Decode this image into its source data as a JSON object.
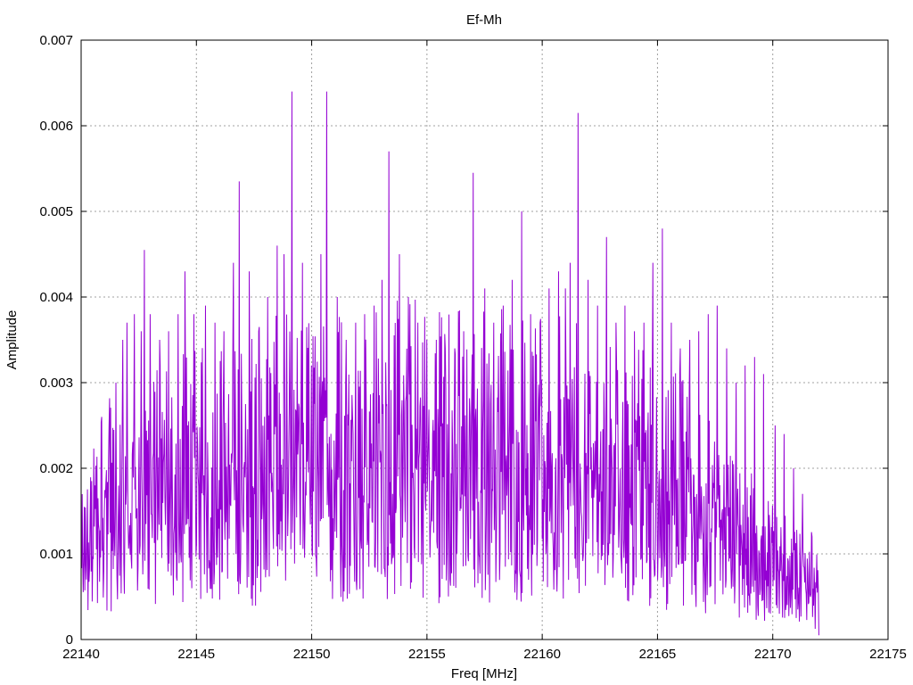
{
  "chart_data": {
    "type": "line",
    "title": "Ef-Mh",
    "xlabel": "Freq [MHz]",
    "ylabel": "Amplitude",
    "xlim": [
      22140,
      22175
    ],
    "ylim": [
      0,
      0.007
    ],
    "xticks": [
      22140,
      22145,
      22150,
      22155,
      22160,
      22165,
      22170,
      22175
    ],
    "yticks": [
      0,
      0.001,
      0.002,
      0.003,
      0.004,
      0.005,
      0.006,
      0.007
    ],
    "xtick_labels": [
      "22140",
      "22145",
      "22150",
      "22155",
      "22160",
      "22165",
      "22170",
      "22175"
    ],
    "ytick_labels": [
      "0",
      "0.001",
      "0.002",
      "0.003",
      "0.004",
      "0.005",
      "0.006",
      "0.007"
    ],
    "grid": true,
    "line_color": "#9400d3",
    "series": [
      {
        "x_start": 22140.0,
        "x_end": 22172.0,
        "peaks": [
          [
            22140.6,
            0.0018
          ],
          [
            22140.9,
            0.0026
          ],
          [
            22141.2,
            0.0025
          ],
          [
            22141.5,
            0.003
          ],
          [
            22141.8,
            0.0035
          ],
          [
            22142.0,
            0.0037
          ],
          [
            22142.3,
            0.0038
          ],
          [
            22142.6,
            0.0036
          ],
          [
            22142.75,
            0.00455
          ],
          [
            22143.0,
            0.0038
          ],
          [
            22143.4,
            0.0035
          ],
          [
            22143.8,
            0.0036
          ],
          [
            22144.2,
            0.0038
          ],
          [
            22144.5,
            0.0043
          ],
          [
            22144.9,
            0.0038
          ],
          [
            22145.4,
            0.0039
          ],
          [
            22145.8,
            0.0037
          ],
          [
            22146.2,
            0.0036
          ],
          [
            22146.6,
            0.0044
          ],
          [
            22146.85,
            0.00535
          ],
          [
            22147.3,
            0.0043
          ],
          [
            22147.7,
            0.0036
          ],
          [
            22148.1,
            0.004
          ],
          [
            22148.5,
            0.0046
          ],
          [
            22148.8,
            0.0045
          ],
          [
            22149.15,
            0.0064
          ],
          [
            22149.6,
            0.0044
          ],
          [
            22150.0,
            0.0032
          ],
          [
            22150.4,
            0.0045
          ],
          [
            22150.65,
            0.0064
          ],
          [
            22151.1,
            0.004
          ],
          [
            22151.5,
            0.0035
          ],
          [
            22151.9,
            0.0037
          ],
          [
            22152.3,
            0.0038
          ],
          [
            22152.7,
            0.0039
          ],
          [
            22153.05,
            0.0042
          ],
          [
            22153.35,
            0.0057
          ],
          [
            22153.8,
            0.0045
          ],
          [
            22154.2,
            0.004
          ],
          [
            22154.6,
            0.0037
          ],
          [
            22155.0,
            0.0035
          ],
          [
            22155.4,
            0.0035
          ],
          [
            22155.8,
            0.0034
          ],
          [
            22156.2,
            0.0034
          ],
          [
            22156.6,
            0.0036
          ],
          [
            22157.0,
            0.00545
          ],
          [
            22157.5,
            0.0041
          ],
          [
            22157.9,
            0.0037
          ],
          [
            22158.3,
            0.0039
          ],
          [
            22158.7,
            0.0042
          ],
          [
            22159.1,
            0.005
          ],
          [
            22159.5,
            0.0038
          ],
          [
            22159.9,
            0.0037
          ],
          [
            22160.3,
            0.0041
          ],
          [
            22160.7,
            0.0043
          ],
          [
            22161.0,
            0.0041
          ],
          [
            22161.2,
            0.0044
          ],
          [
            22161.55,
            0.00615
          ],
          [
            22162.0,
            0.0042
          ],
          [
            22162.4,
            0.0039
          ],
          [
            22162.8,
            0.0047
          ],
          [
            22163.2,
            0.0037
          ],
          [
            22163.6,
            0.0039
          ],
          [
            22164.0,
            0.0036
          ],
          [
            22164.4,
            0.0037
          ],
          [
            22164.8,
            0.0044
          ],
          [
            22165.2,
            0.0048
          ],
          [
            22165.6,
            0.0037
          ],
          [
            22166.0,
            0.0034
          ],
          [
            22166.4,
            0.0035
          ],
          [
            22166.8,
            0.0036
          ],
          [
            22167.2,
            0.0038
          ],
          [
            22167.6,
            0.0039
          ],
          [
            22168.0,
            0.0034
          ],
          [
            22168.4,
            0.003
          ],
          [
            22168.8,
            0.0032
          ],
          [
            22169.2,
            0.0033
          ],
          [
            22169.6,
            0.0031
          ],
          [
            22170.1,
            0.0025
          ],
          [
            22170.5,
            0.0024
          ],
          [
            22170.9,
            0.002
          ],
          [
            22171.3,
            0.0017
          ],
          [
            22171.7,
            0.0012
          ],
          [
            22172.0,
            0.0005
          ]
        ]
      }
    ]
  }
}
